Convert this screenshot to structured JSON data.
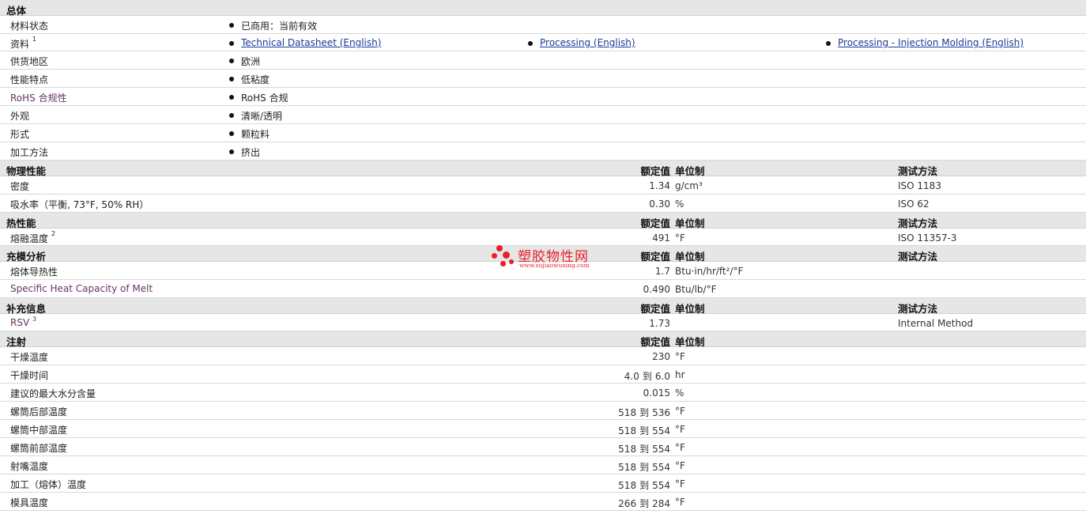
{
  "general": {
    "title": "总体",
    "rows": [
      {
        "label": "材料状态",
        "items": [
          "已商用：当前有效"
        ]
      },
      {
        "label": "资料",
        "sup": "1",
        "items": [
          "Technical Datasheet (English)",
          "Processing (English)",
          "Processing - Injection Molding (English)"
        ]
      },
      {
        "label": "供货地区",
        "items": [
          "欧洲"
        ]
      },
      {
        "label": "性能特点",
        "items": [
          "低粘度"
        ]
      },
      {
        "label": "RoHS 合规性",
        "items": [
          "RoHS 合规"
        ]
      },
      {
        "label": "外观",
        "items": [
          "清晰/透明"
        ]
      },
      {
        "label": "形式",
        "items": [
          "颗粒料"
        ]
      },
      {
        "label": "加工方法",
        "items": [
          "挤出"
        ]
      }
    ]
  },
  "headers": {
    "value": "额定值",
    "unit": "单位制",
    "test": "测试方法"
  },
  "physical": {
    "title": "物理性能",
    "rows": [
      {
        "label": "密度",
        "value": "1.34",
        "unit": "g/cm³",
        "test": "ISO 1183"
      },
      {
        "label": "吸水率（平衡, 73°F, 50% RH）",
        "value": "0.30",
        "unit": "%",
        "test": "ISO 62"
      }
    ]
  },
  "thermal": {
    "title": "热性能",
    "rows": [
      {
        "label": "熔融温度",
        "sup": "2",
        "value": "491",
        "unit": "°F",
        "test": "ISO 11357-3"
      }
    ]
  },
  "filling": {
    "title": "充模分析",
    "rows": [
      {
        "label": "熔体导热性",
        "value": "1.7",
        "unit": "Btu·in/hr/ft²/°F",
        "test": ""
      },
      {
        "label": "Specific Heat Capacity of Melt",
        "value": "0.490",
        "unit": "Btu/lb/°F",
        "test": ""
      }
    ]
  },
  "supplement": {
    "title": "补充信息",
    "rows": [
      {
        "label": "RSV",
        "sup": "3",
        "value": "1.73",
        "unit": "",
        "test": "Internal Method"
      }
    ]
  },
  "injection": {
    "title": "注射",
    "to": "到",
    "rows": [
      {
        "label": "干燥温度",
        "value": "230",
        "unit": "°F"
      },
      {
        "label": "干燥时间",
        "min": "4.0",
        "max": "6.0",
        "unit": "hr"
      },
      {
        "label": "建议的最大水分含量",
        "value": "0.015",
        "unit": "%"
      },
      {
        "label": "螺筒后部温度",
        "min": "518",
        "max": "536",
        "unit": "°F"
      },
      {
        "label": "螺筒中部温度",
        "min": "518",
        "max": "554",
        "unit": "°F"
      },
      {
        "label": "螺筒前部温度",
        "min": "518",
        "max": "554",
        "unit": "°F"
      },
      {
        "label": "射嘴温度",
        "min": "518",
        "max": "554",
        "unit": "°F"
      },
      {
        "label": "加工（熔体）温度",
        "min": "518",
        "max": "554",
        "unit": "°F"
      },
      {
        "label": "模具温度",
        "min": "266",
        "max": "284",
        "unit": "°F"
      }
    ]
  },
  "watermark": {
    "text": "塑胶物性网",
    "url": "www.sujiaowuxing.com"
  },
  "colors": {
    "section_bg": "#e6e6e6",
    "link": "#1a3a9a",
    "purple_label": "#663366",
    "watermark": "#e8202a"
  }
}
